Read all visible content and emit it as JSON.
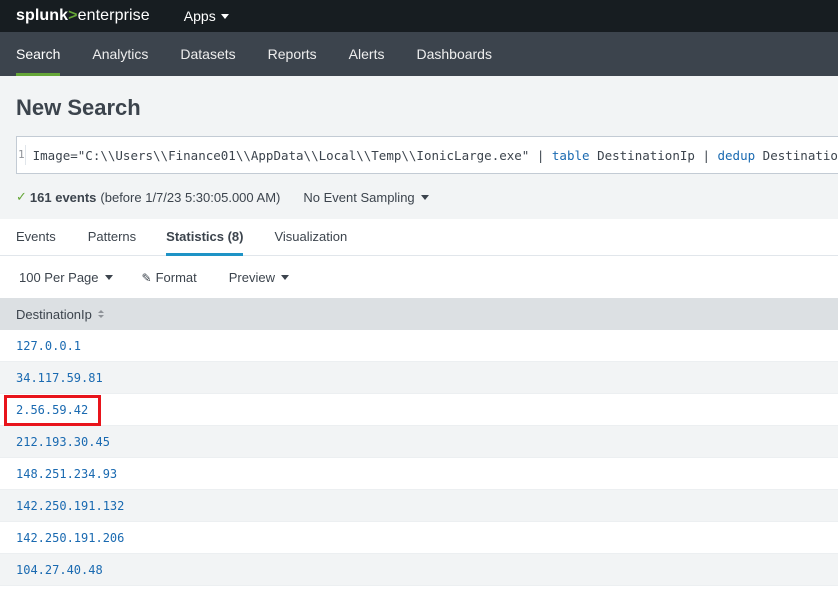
{
  "brand": {
    "part1": "splunk",
    "part2": ">",
    "part3": "enterprise"
  },
  "apps_menu": {
    "label": "Apps"
  },
  "nav": [
    {
      "label": "Search"
    },
    {
      "label": "Analytics"
    },
    {
      "label": "Datasets"
    },
    {
      "label": "Reports"
    },
    {
      "label": "Alerts"
    },
    {
      "label": "Dashboards"
    }
  ],
  "page_title": "New Search",
  "search": {
    "line_number": "1",
    "q_part1": "Image=\"C:\\\\Users\\\\Finance01\\\\AppData\\\\Local\\\\Temp\\\\IonicLarge.exe\" ",
    "pipe1": "| ",
    "cmd1": "table",
    "arg1": " DestinationIp ",
    "pipe2": "| ",
    "cmd2": "dedup",
    "arg2": " DestinationIp"
  },
  "status": {
    "check": "✓",
    "events": "161 events",
    "detail": "(before 1/7/23 5:30:05.000 AM)",
    "sampling": "No Event Sampling"
  },
  "tabs": [
    {
      "label": "Events"
    },
    {
      "label": "Patterns"
    },
    {
      "label": "Statistics (8)"
    },
    {
      "label": "Visualization"
    }
  ],
  "toolbar": {
    "per_page": "100 Per Page",
    "format_icon": "✎",
    "format": "Format",
    "preview": "Preview"
  },
  "table": {
    "column": "DestinationIp",
    "rows": [
      "127.0.0.1",
      "34.117.59.81",
      "2.56.59.42",
      "212.193.30.45",
      "148.251.234.93",
      "142.250.191.132",
      "142.250.191.206",
      "104.27.40.48"
    ]
  },
  "colors": {
    "accent_green": "#65a637",
    "link_blue": "#1a6ab1",
    "highlight_red": "#e8141b"
  }
}
